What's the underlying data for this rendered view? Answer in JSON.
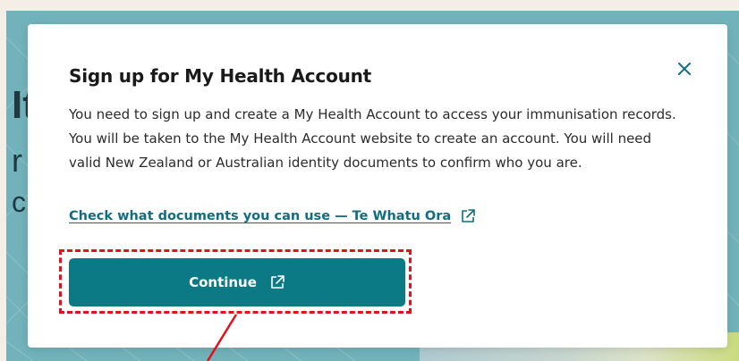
{
  "background": {
    "headline_fragments": [
      "It",
      "r",
      "c"
    ]
  },
  "modal": {
    "title": "Sign up for My Health Account",
    "body": "You need to sign up and create a My Health Account to access your immunisation records. You will be taken to the My Health Account website to create an account. You will need valid New Zealand or Australian identity documents to confirm who you are.",
    "docs_link": "Check what documents you can use — Te Whatu Ora",
    "continue_label": "Continue",
    "icons": {
      "close": "close-icon",
      "external_link": "external-link-icon"
    }
  },
  "colors": {
    "accent": "#0c7a85",
    "link": "#0f6d85",
    "annotation": "#e0121e",
    "overlay_teal": "#72b3bb"
  }
}
